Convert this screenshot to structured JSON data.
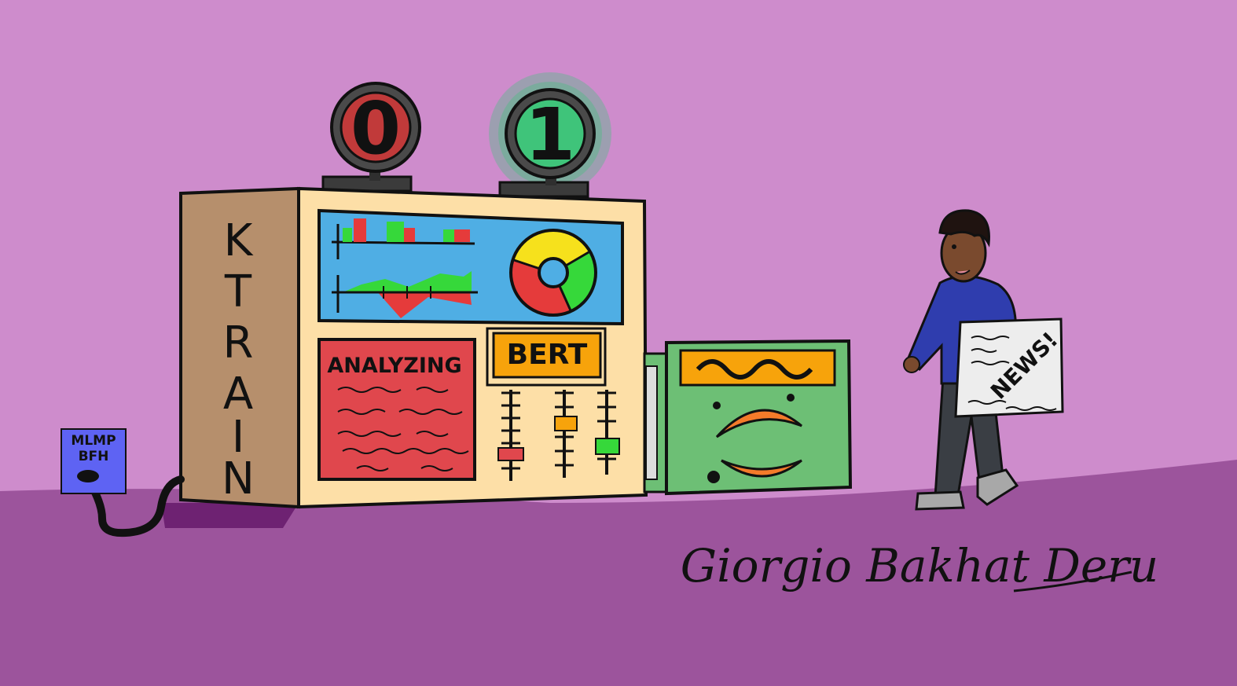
{
  "scene": {
    "background_color": "#CE8CCC",
    "ground_color": "#9C549C",
    "shadow_color": "#6E2272"
  },
  "lights": {
    "left": {
      "digit": "0",
      "color": "#C13A3A",
      "glow": false
    },
    "right": {
      "digit": "1",
      "color": "#3FC47A",
      "glow": true
    }
  },
  "machine": {
    "side_label": [
      "K",
      "T",
      "R",
      "A",
      "I",
      "N"
    ],
    "analyzing_label": "ANALYZING",
    "model_label": "BERT",
    "colors": {
      "body": "#FDDFA7",
      "side": "#B68F6C",
      "screen": "#4FAEE4",
      "analyzing_panel": "#E0474D",
      "model_badge": "#F7A30B",
      "module": "#6DBF75"
    }
  },
  "outlet": {
    "label_line1": "MLMP",
    "label_line2": "BFH",
    "color": "#5E63F3"
  },
  "person": {
    "sign_text": "NEWS!",
    "shirt_color": "#2F3DAE",
    "pants_color": "#3A3E44"
  },
  "signature": "Giorgio Bakhat Deru"
}
